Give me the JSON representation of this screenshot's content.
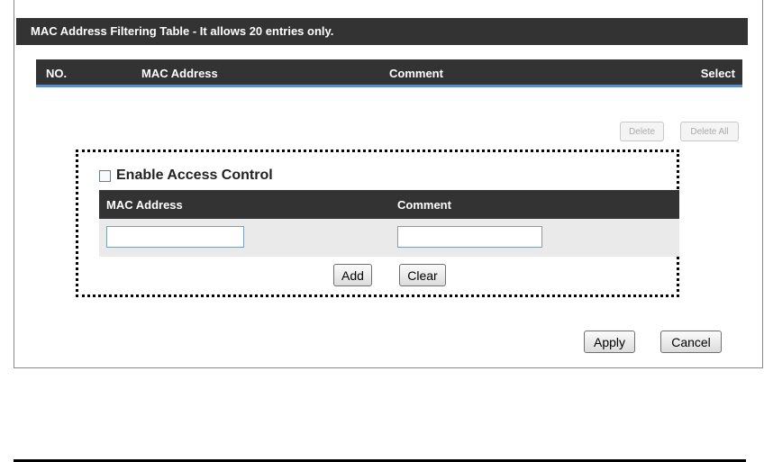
{
  "filter_table": {
    "title": "MAC Address Filtering Table - It allows 20 entries only.",
    "columns": [
      "NO.",
      "MAC Address",
      "Comment",
      "Select"
    ],
    "delete_label": "Delete",
    "delete_all_label": "Delete All"
  },
  "access_control": {
    "enable_label": "Enable Access Control",
    "enabled": false,
    "mac_header": "MAC Address",
    "comment_header": "Comment",
    "mac_value": "",
    "comment_value": "",
    "add_label": "Add",
    "clear_label": "Clear"
  },
  "footer": {
    "apply_label": "Apply",
    "cancel_label": "Cancel"
  },
  "colors": {
    "header_bg": "#333333",
    "header_accent": "#5b8fc4",
    "row_bg": "#eaeaea"
  }
}
